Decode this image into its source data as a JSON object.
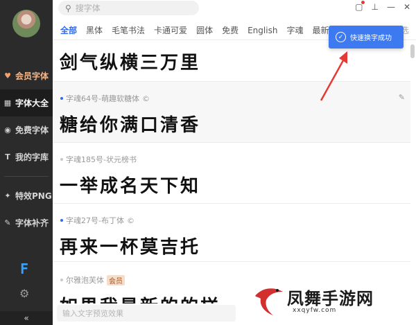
{
  "sidebar": {
    "items": [
      {
        "label": "会员字体",
        "icon": "heart-icon",
        "state": "vip"
      },
      {
        "label": "字体大全",
        "icon": "grid-icon",
        "state": "active"
      },
      {
        "label": "免费字体",
        "icon": "free-icon",
        "state": "normal"
      },
      {
        "label": "我的字库",
        "icon": "font-tt-icon",
        "state": "normal"
      }
    ],
    "tools": [
      {
        "label": "特效PNG",
        "icon": "effect-icon"
      },
      {
        "label": "字体补齐",
        "icon": "wrench-icon"
      }
    ],
    "collapse_label": "«"
  },
  "search": {
    "placeholder": "搜字体"
  },
  "tabs": [
    "全部",
    "黑体",
    "毛笔书法",
    "卡通可爱",
    "圆体",
    "免费",
    "English",
    "字魂",
    "最新"
  ],
  "tabs_more": "筛选",
  "toast": {
    "text": "快速换字成功"
  },
  "fonts": [
    {
      "name": "",
      "preview": "剑气纵横三万里",
      "badge": ""
    },
    {
      "name": "字魂64号-萌趣软糖体",
      "preview": "糖给你满口清香",
      "badge": ""
    },
    {
      "name": "字魂185号-状元榜书",
      "preview": "一举成名天下知",
      "badge": ""
    },
    {
      "name": "字魂27号-布丁体",
      "preview": "再来一杯莫吉托",
      "badge": ""
    },
    {
      "name": "尔雅泡芙体",
      "preview": "如果我是新的的样",
      "badge": "会员"
    }
  ],
  "copyright_mark": "©",
  "bottom_input": {
    "placeholder": "输入文字预览效果"
  },
  "watermark": {
    "title": "凤舞手游网",
    "url": "xxqyfw.com"
  },
  "colors": {
    "sidebar_bg": "#2b2b2b",
    "accent_blue": "#2d6bf0",
    "toast_bg": "#3d7af2",
    "vip_orange": "#f5a06b"
  }
}
